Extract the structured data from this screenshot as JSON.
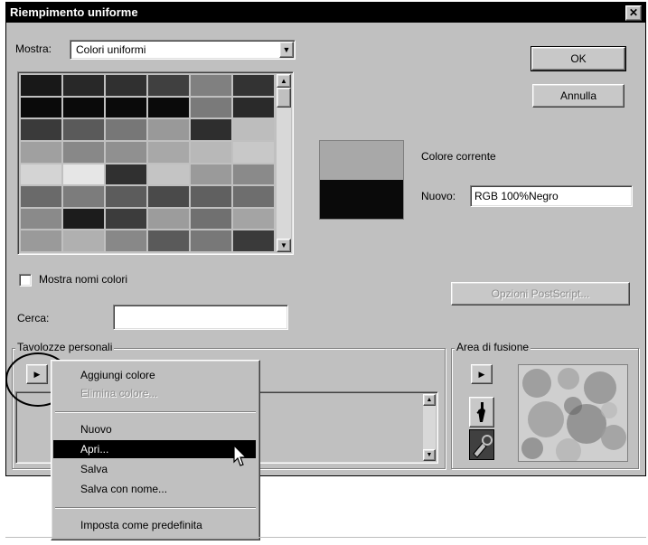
{
  "dialog": {
    "title": "Riempimento uniforme",
    "close_glyph": "✕"
  },
  "mostra": {
    "label": "Mostra:",
    "value": "Colori uniformi",
    "arrow": "▼"
  },
  "palette": {
    "swatch_colors": [
      [
        "#181818",
        "#282828",
        "#303030",
        "#404040",
        "#808080",
        "#333333"
      ],
      [
        "#0a0a0a",
        "#0a0a0a",
        "#0a0a0a",
        "#0a0a0a",
        "#7a7a7a",
        "#2a2a2a"
      ],
      [
        "#3a3a3a",
        "#5a5a5a",
        "#777777",
        "#999999",
        "#2e2e2e",
        "#bdbdbd"
      ],
      [
        "#a0a0a0",
        "#888888",
        "#909090",
        "#a8a8a8",
        "#b8b8b8",
        "#c8c8c8"
      ],
      [
        "#d4d4d4",
        "#e6e6e6",
        "#303030",
        "#c4c4c4",
        "#9a9a9a",
        "#8a8a8a"
      ],
      [
        "#6a6a6a",
        "#7c7c7c",
        "#5c5c5c",
        "#4a4a4a",
        "#606060",
        "#6e6e6e"
      ],
      [
        "#8a8a8a",
        "#1c1c1c",
        "#3c3c3c",
        "#9c9c9c",
        "#707070",
        "#a4a4a4"
      ],
      [
        "#9a9a9a",
        "#b0b0b0",
        "#888888",
        "#5a5a5a",
        "#787878",
        "#3a3a3a"
      ]
    ]
  },
  "preview": {
    "old_color": "#a8a8a8",
    "new_color": "#0a0a0a",
    "current_label": "Colore corrente",
    "new_label": "Nuovo:",
    "new_value": "RGB 100%Negro"
  },
  "buttons": {
    "ok": "OK",
    "cancel": "Annulla",
    "postscript": "Opzioni PostScript..."
  },
  "show_names": {
    "label": "Mostra nomi colori",
    "checked": false
  },
  "search": {
    "label": "Cerca:",
    "value": ""
  },
  "custom_palette": {
    "label": "Tavolozze personali",
    "arrow": "▶"
  },
  "blend_area": {
    "label": "Area di fusione",
    "arrow": "▶"
  },
  "context_menu": {
    "add_color": "Aggiungi colore",
    "delete_color": "Elimina colore...",
    "new": "Nuovo",
    "open": "Apri...",
    "save": "Salva",
    "save_as": "Salva con nome...",
    "set_default": "Imposta come predefinita"
  }
}
